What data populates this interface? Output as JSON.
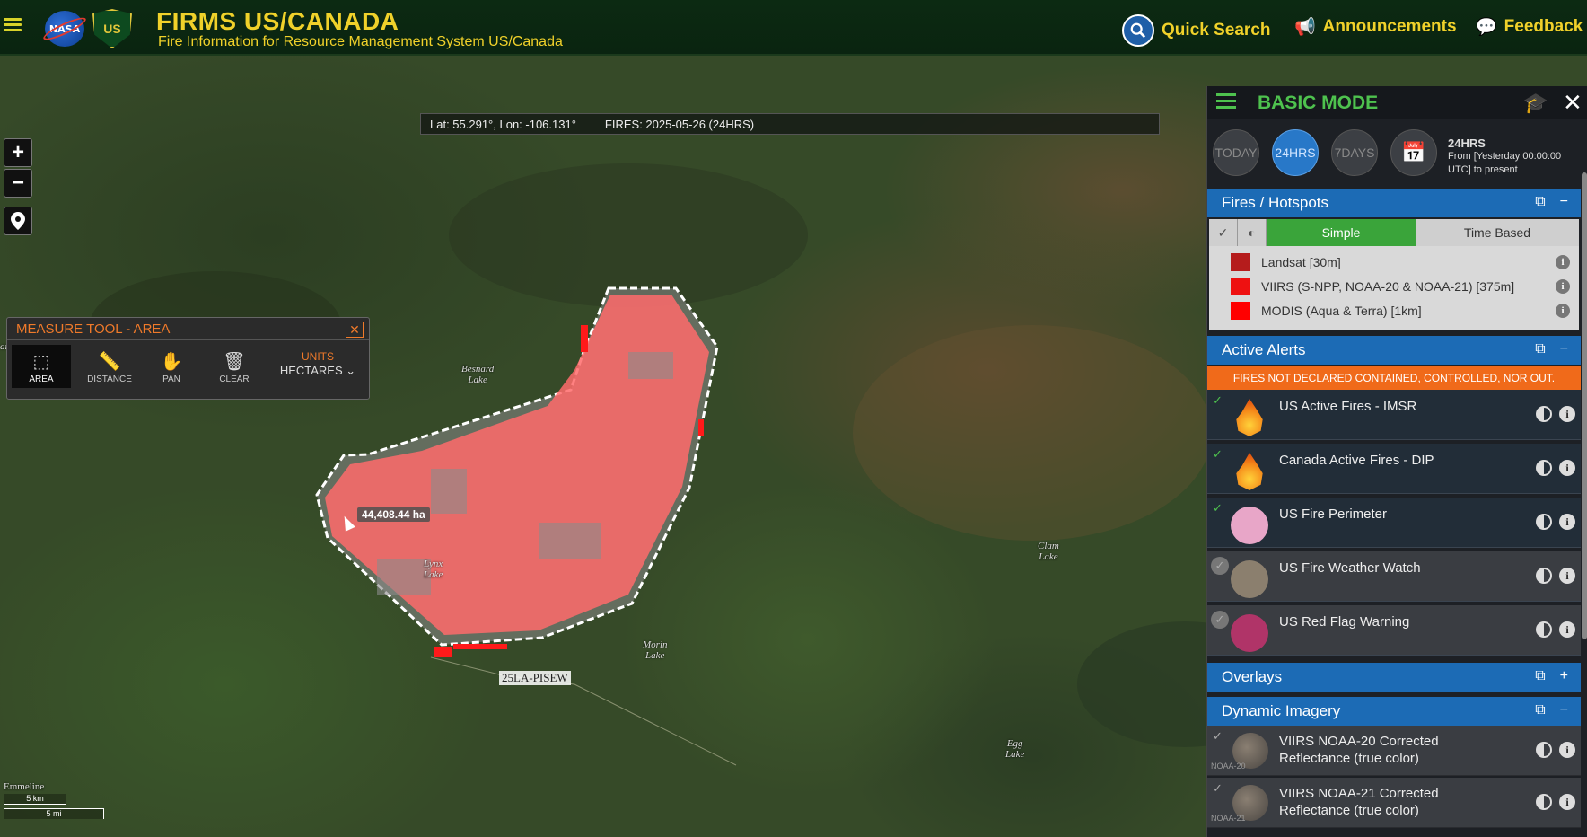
{
  "header": {
    "title": "FIRMS US/CANADA",
    "subtitle": "Fire Information for Resource Management System US/Canada",
    "nasa_logo": "NASA",
    "usfs_logo": "US",
    "quick_search": "Quick Search",
    "announcements": "Announcements",
    "feedback": "Feedback"
  },
  "map": {
    "coords": "Lat: 55.291°, Lon: -106.131°",
    "fires_date": "FIRES: 2025-05-26 (24HRS)",
    "zoom_in": "+",
    "zoom_out": "−",
    "area_measurement": "44,408.44 ha",
    "fire_label": "25LA-PISEW",
    "lakes": {
      "lake_left": "ar Lake",
      "besnard": "Besnard\nLake",
      "lynx": "Lynx\nLake",
      "morin": "Morin\nLake",
      "clam": "Clam\nLake",
      "egg": "Egg\nLake",
      "emmeline": "Emmeline"
    },
    "scale_km": "5 km",
    "scale_mi": "5 mi"
  },
  "measure_tool": {
    "title": "MEASURE TOOL - AREA",
    "close": "✕",
    "tools": {
      "area": "AREA",
      "distance": "DISTANCE",
      "pan": "PAN",
      "clear": "CLEAR"
    },
    "units_label": "UNITS",
    "units_value": "HECTARES ⌄"
  },
  "panel": {
    "mode_title": "BASIC MODE",
    "time_buttons": {
      "today": "TODAY",
      "hrs24": "24HRS",
      "days7": "7DAYS"
    },
    "time_info_title": "24HRS",
    "time_info_text": "From [Yesterday 00:00:00 UTC] to present",
    "fires_section": {
      "title": "Fires / Hotspots",
      "tab_simple": "Simple",
      "tab_time": "Time Based",
      "layers": [
        {
          "name": "Landsat [30m]",
          "color": "#b51c1c"
        },
        {
          "name": "VIIRS (S-NPP, NOAA-20 & NOAA-21) [375m]",
          "color": "#ee1111"
        },
        {
          "name": "MODIS (Aqua & Terra) [1km]",
          "color": "#ff0000"
        }
      ]
    },
    "alerts_section": {
      "title": "Active Alerts",
      "banner": "FIRES NOT DECLARED CONTAINED, CONTROLLED, NOR OUT.",
      "items": [
        {
          "name": "US Active Fires - IMSR",
          "enabled": true,
          "icon": "flame-icon"
        },
        {
          "name": "Canada Active Fires - DIP",
          "enabled": true,
          "icon": "flame-icon"
        },
        {
          "name": "US Fire Perimeter",
          "enabled": true,
          "color": "#e8a6c8"
        },
        {
          "name": "US Fire Weather Watch",
          "enabled": false,
          "color": "#8b7f6e"
        },
        {
          "name": "US Red Flag Warning",
          "enabled": false,
          "color": "#b03468"
        }
      ]
    },
    "overlays_section": {
      "title": "Overlays"
    },
    "imagery_section": {
      "title": "Dynamic Imagery",
      "items": [
        {
          "name": "VIIRS NOAA-20 Corrected Reflectance (true color)",
          "tag": "NOAA-20"
        },
        {
          "name": "VIIRS NOAA-21 Corrected Reflectance (true color)",
          "tag": "NOAA-21"
        }
      ]
    }
  }
}
